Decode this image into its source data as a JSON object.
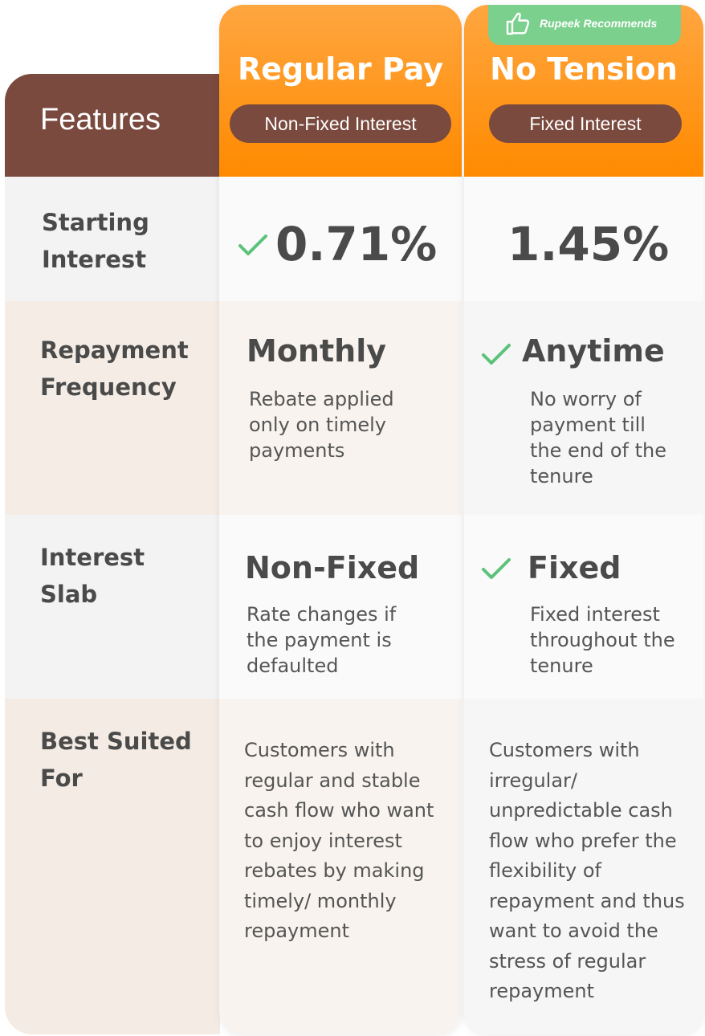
{
  "features": {
    "header": "Features",
    "rows": [
      "Starting Interest",
      "Repayment Frequency",
      "Interest Slab",
      "Best Suited For"
    ]
  },
  "plans": [
    {
      "title": "Regular Pay",
      "pill": "Non-Fixed Interest",
      "starting_interest": "0.71%",
      "repayment_title": "Monthly",
      "repayment_desc": "Rebate applied only on timely payments",
      "slab_title": "Non-Fixed",
      "slab_desc": "Rate changes if the payment is defaulted",
      "best_suited": "Customers with regular and stable cash flow who want to enjoy interest rebates by making timely/ monthly repayment"
    },
    {
      "title": "No Tension",
      "pill": "Fixed Interest",
      "badge": "Rupeek Recommends",
      "starting_interest": "1.45%",
      "repayment_title": "Anytime",
      "repayment_desc": "No worry of payment till the end of the tenure",
      "slab_title": "Fixed",
      "slab_desc": "Fixed interest throughout the tenure",
      "best_suited": "Customers with irregular/ unpredictable cash flow who prefer the flexibility of repayment and thus want to avoid the stress of regular repayment"
    }
  ],
  "colors": {
    "brown": "#7a4a3e",
    "orange": "#ff8a00",
    "green_check": "#5cc27a",
    "badge_green": "#7ad08c"
  },
  "icons": [
    "check-icon",
    "thumbs-up-icon"
  ]
}
